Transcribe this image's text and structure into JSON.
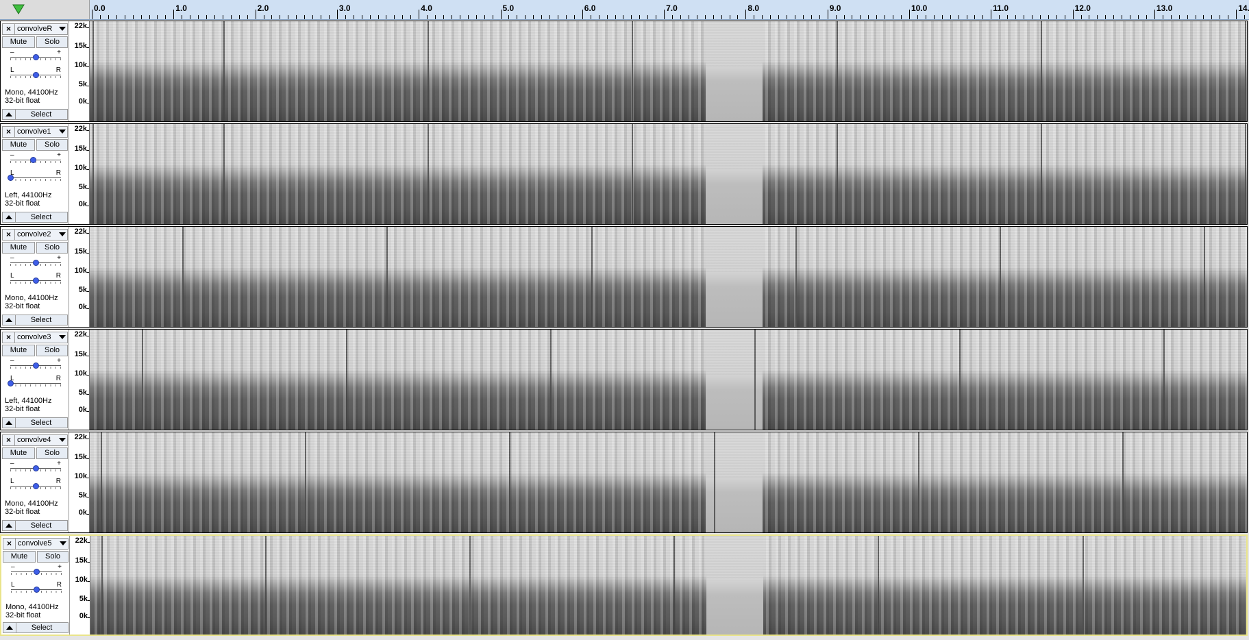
{
  "ruler": {
    "labels": [
      "0.0",
      "1.0",
      "2.0",
      "3.0",
      "4.0",
      "5.0",
      "6.0",
      "7.0",
      "8.0",
      "9.0",
      "10.0",
      "11.0",
      "12.0",
      "13.0",
      "14.0"
    ]
  },
  "colors": {
    "ruler_bg": "#cfe0f3",
    "play_icon": "#3fbf3f",
    "knob": "#3f5ee8",
    "selected_track_border": "#e9e48a"
  },
  "tracks": [
    {
      "name": "convolveR",
      "mute": "Mute",
      "solo": "Solo",
      "gain_minus": "–",
      "gain_plus": "+",
      "pan_l": "L",
      "pan_r": "R",
      "gain": 0.5,
      "pan": 0.5,
      "info1": "Mono, 44100Hz",
      "info2": "32-bit float",
      "select": "Select",
      "freq": [
        "22k",
        "15k",
        "10k",
        "5k",
        "0k"
      ],
      "pulses": [
        0,
        1.6,
        4.1,
        6.6,
        9.1,
        11.6,
        14.1
      ]
    },
    {
      "name": "convolve1",
      "mute": "Mute",
      "solo": "Solo",
      "gain_minus": "–",
      "gain_plus": "+",
      "pan_l": "L",
      "pan_r": "R",
      "gain": 0.45,
      "pan": 0.0,
      "info1": "Left, 44100Hz",
      "info2": "32-bit float",
      "select": "Select",
      "freq": [
        "22k",
        "15k",
        "10k",
        "5k",
        "0k"
      ],
      "pulses": [
        0,
        1.6,
        4.1,
        6.6,
        9.1,
        11.6,
        14.1
      ]
    },
    {
      "name": "convolve2",
      "mute": "Mute",
      "solo": "Solo",
      "gain_minus": "–",
      "gain_plus": "+",
      "pan_l": "L",
      "pan_r": "R",
      "gain": 0.5,
      "pan": 0.5,
      "info1": "Mono, 44100Hz",
      "info2": "32-bit float",
      "select": "Select",
      "freq": [
        "22k",
        "15k",
        "10k",
        "5k",
        "0k"
      ],
      "pulses": [
        1.1,
        3.6,
        6.1,
        8.6,
        11.1,
        13.6
      ]
    },
    {
      "name": "convolve3",
      "mute": "Mute",
      "solo": "Solo",
      "gain_minus": "–",
      "gain_plus": "+",
      "pan_l": "L",
      "pan_r": "R",
      "gain": 0.5,
      "pan": 0.0,
      "info1": "Left, 44100Hz",
      "info2": "32-bit float",
      "select": "Select",
      "freq": [
        "22k",
        "15k",
        "10k",
        "5k",
        "0k"
      ],
      "pulses": [
        0.6,
        3.1,
        5.6,
        8.1,
        10.6,
        13.1
      ]
    },
    {
      "name": "convolve4",
      "mute": "Mute",
      "solo": "Solo",
      "gain_minus": "–",
      "gain_plus": "+",
      "pan_l": "L",
      "pan_r": "R",
      "gain": 0.5,
      "pan": 0.5,
      "info1": "Mono, 44100Hz",
      "info2": "32-bit float",
      "select": "Select",
      "freq": [
        "22k",
        "15k",
        "10k",
        "5k",
        "0k"
      ],
      "pulses": [
        0.1,
        2.6,
        5.1,
        7.6,
        10.1,
        12.6
      ]
    },
    {
      "name": "convolve5",
      "mute": "Mute",
      "solo": "Solo",
      "gain_minus": "–",
      "gain_plus": "+",
      "pan_l": "L",
      "pan_r": "R",
      "gain": 0.5,
      "pan": 0.5,
      "info1": "Mono, 44100Hz",
      "info2": "32-bit float",
      "select": "Select",
      "freq": [
        "22k",
        "15k",
        "10k",
        "5k",
        "0k"
      ],
      "pulses": [
        0.1,
        2.1,
        4.6,
        7.1,
        9.6,
        12.1
      ],
      "selected": true
    }
  ]
}
